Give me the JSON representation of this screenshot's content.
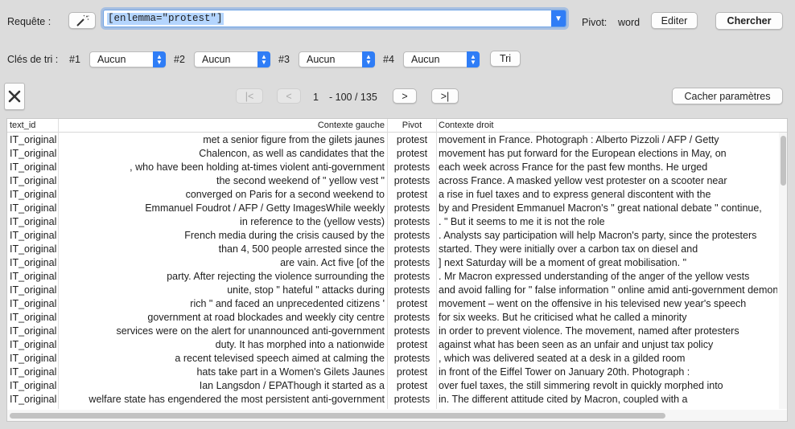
{
  "query": {
    "label": "Requête :",
    "value": "[enlemma=\"protest\"]",
    "pivot_label": "Pivot:",
    "pivot_value": "word",
    "edit_button": "Editer",
    "search_button": "Chercher"
  },
  "sort": {
    "label": "Clés de tri :",
    "keys": [
      {
        "num": "#1",
        "value": "Aucun"
      },
      {
        "num": "#2",
        "value": "Aucun"
      },
      {
        "num": "#3",
        "value": "Aucun"
      },
      {
        "num": "#4",
        "value": "Aucun"
      }
    ],
    "sort_button": "Tri"
  },
  "pagination": {
    "first": "|<",
    "prev": "<",
    "current": "1",
    "range": "- 100 / 135",
    "next": ">",
    "last": ">|",
    "hide_params_button": "Cacher paramètres"
  },
  "table": {
    "headers": {
      "text_id": "text_id",
      "left": "Contexte gauche",
      "pivot": "Pivot",
      "right": "Contexte droit"
    },
    "rows": [
      {
        "id": "IT_original",
        "left": "met a senior figure from the gilets jaunes",
        "pivot": "protest",
        "right": "movement in France. Photograph : Alberto Pizzoli / AFP / Getty"
      },
      {
        "id": "IT_original",
        "left": "Chalencon, as well as candidates that the",
        "pivot": "protest",
        "right": "movement has put forward for the European elections in May, on"
      },
      {
        "id": "IT_original",
        "left": ", who have been holding at-times violent anti-government",
        "pivot": "protests",
        "right": "each week across France for the past few months. He urged"
      },
      {
        "id": "IT_original",
        "left": "the second weekend of \" yellow vest \"",
        "pivot": "protests",
        "right": "across France. A masked yellow vest protester on a scooter near"
      },
      {
        "id": "IT_original",
        "left": "converged on Paris for a second weekend to",
        "pivot": "protest",
        "right": "a rise in fuel taxes and to express general discontent with the"
      },
      {
        "id": "IT_original",
        "left": "Emmanuel Foudrot / AFP / Getty ImagesWhile weekly",
        "pivot": "protests",
        "right": "by and President Emmanuel Macron's \" great national debate \" continue,"
      },
      {
        "id": "IT_original",
        "left": "in reference to the (yellow vests)",
        "pivot": "protests",
        "right": ". \" But it seems to me it is not the role"
      },
      {
        "id": "IT_original",
        "left": "French media during the crisis caused by the",
        "pivot": "protests",
        "right": ". Analysts say participation will help Macron's party, since the protesters"
      },
      {
        "id": "IT_original",
        "left": "than 4, 500 people arrested since the",
        "pivot": "protests",
        "right": "started. They were initially over a carbon tax on diesel and"
      },
      {
        "id": "IT_original",
        "left": "are vain. Act five [of the",
        "pivot": "protests",
        "right": "] next Saturday will be a moment of great mobilisation. \""
      },
      {
        "id": "IT_original",
        "left": "party. After rejecting the violence surrounding the",
        "pivot": "protests",
        "right": ". Mr Macron expressed understanding of the anger of the yellow vests"
      },
      {
        "id": "IT_original",
        "left": "unite, stop \" hateful \" attacks during",
        "pivot": "protests",
        "right": "and avoid falling for \" false information \" online amid anti-government demonstrations"
      },
      {
        "id": "IT_original",
        "left": "rich \" and faced an unprecedented citizens '",
        "pivot": "protest",
        "right": "movement – went on the offensive in his televised new year's speech"
      },
      {
        "id": "IT_original",
        "left": "government at road blockades and weekly city centre",
        "pivot": "protests",
        "right": "for six weeks. But he criticised what he called a minority"
      },
      {
        "id": "IT_original",
        "left": "services were on the alert for unannounced anti-government",
        "pivot": "protests",
        "right": "in order to prevent violence. The movement, named after protesters"
      },
      {
        "id": "IT_original",
        "left": "duty. It has morphed into a nationwide",
        "pivot": "protest",
        "right": "against what has been seen as an unfair and unjust tax policy"
      },
      {
        "id": "IT_original",
        "left": "a recent televised speech aimed at calming the",
        "pivot": "protests",
        "right": ", which was delivered seated at a desk in a gilded room"
      },
      {
        "id": "IT_original",
        "left": "hats take part in a Women's Gilets Jaunes",
        "pivot": "protest",
        "right": "in front of the Eiffel Tower on January 20th. Photograph :"
      },
      {
        "id": "IT_original",
        "left": "Ian Langsdon / EPAThough it started as a",
        "pivot": "protest",
        "right": "over fuel taxes, the still simmering revolt in quickly morphed into"
      },
      {
        "id": "IT_original",
        "left": "welfare state has engendered the most persistent anti-government",
        "pivot": "protests",
        "right": "in. The different attitude cited by Macron, coupled with a"
      }
    ]
  }
}
